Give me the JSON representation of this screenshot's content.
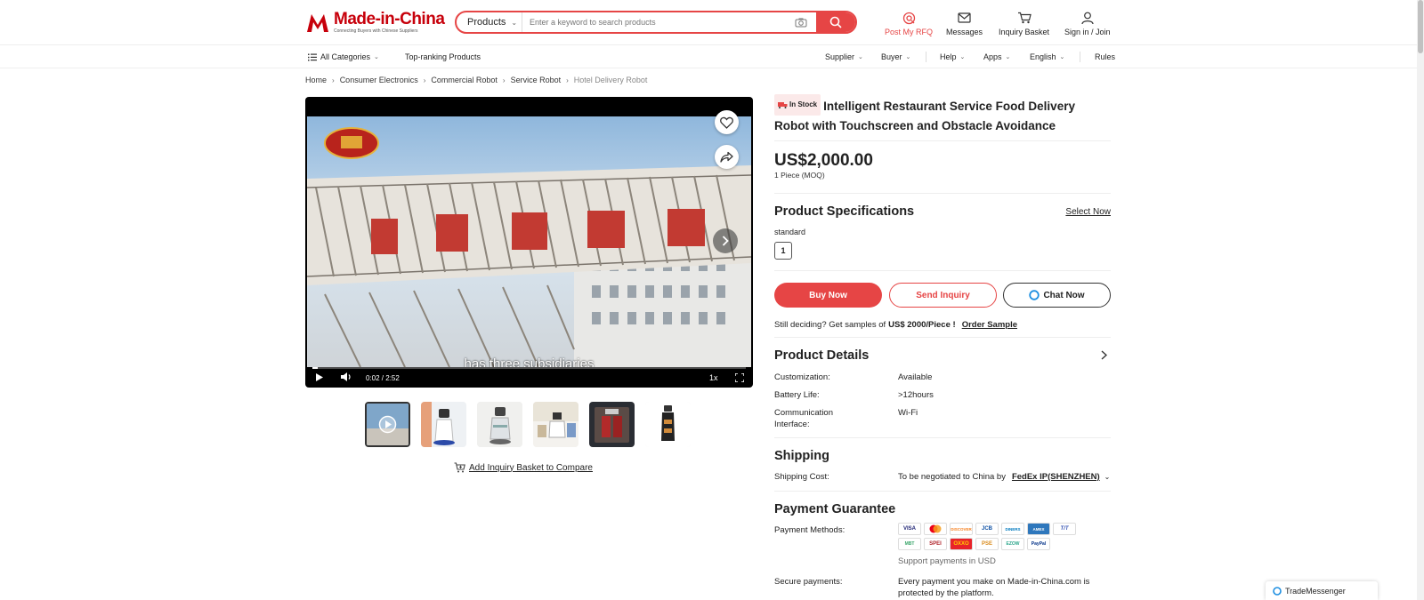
{
  "header": {
    "logo_text": "Made-in-China",
    "logo_tagline": "Connecting Buyers with Chinese Suppliers",
    "search": {
      "category": "Products",
      "placeholder": "Enter a keyword to search products"
    },
    "items": {
      "rfq": "Post My RFQ",
      "messages": "Messages",
      "basket": "Inquiry Basket",
      "signin": "Sign in / Join"
    },
    "accent_color": "#e64545"
  },
  "nav": {
    "all_categories": "All Categories",
    "top_ranking": "Top-ranking Products",
    "supplier": "Supplier",
    "buyer": "Buyer",
    "help": "Help",
    "apps": "Apps",
    "language": "English",
    "rules": "Rules"
  },
  "breadcrumb": [
    "Home",
    "Consumer Electronics",
    "Commercial Robot",
    "Service Robot",
    "Hotel Delivery Robot"
  ],
  "video": {
    "subtitle": "has three subsidiaries",
    "time": "0:02 / 2:52",
    "speed": "1x",
    "progress": 0.013
  },
  "compare_label": "Add Inquiry Basket to Compare",
  "product": {
    "stock_badge": "In Stock",
    "title": "Intelligent Restaurant Service Food Delivery Robot with Touchscreen and Obstacle Avoidance",
    "price": "US$2,000.00",
    "moq": "1 Piece (MOQ)",
    "specs_title": "Product Specifications",
    "select_now": "Select Now",
    "spec_label": "standard",
    "spec_option": "1",
    "buy_now": "Buy Now",
    "send_inquiry": "Send Inquiry",
    "chat_now": "Chat Now",
    "sample_text": "Still deciding? Get samples of",
    "sample_price": "US$ 2000/Piece !",
    "order_sample": "Order Sample",
    "details_title": "Product Details",
    "details": [
      {
        "label": "Customization:",
        "value": "Available"
      },
      {
        "label": "Battery Life:",
        "value": ">12hours"
      },
      {
        "label": "Communication Interface:",
        "value": "Wi-Fi"
      }
    ],
    "shipping_title": "Shipping",
    "shipping_label": "Shipping Cost:",
    "shipping_value": "To be negotiated to China by",
    "shipping_carrier": "FedEx IP(SHENZHEN)",
    "payment_title": "Payment Guarantee",
    "payment_label": "Payment Methods:",
    "payment_methods": [
      "VISA",
      "MC",
      "DISCOVER",
      "JCB",
      "DINERS",
      "AMEX",
      "T/T",
      "MBT",
      "SPEI",
      "OXXO",
      "PSE",
      "EZOW",
      "PayPal"
    ],
    "support": "Support payments in USD",
    "secure_label": "Secure payments:",
    "secure_value": "Every payment you make on Made-in-China.com is protected by the platform."
  },
  "trade_messenger": "TradeMessenger"
}
